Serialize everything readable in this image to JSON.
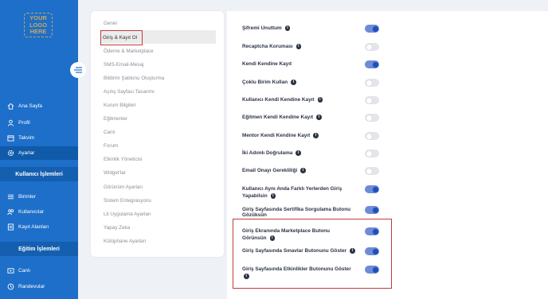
{
  "sidebar": {
    "logo_lines": [
      "YOUR",
      "LOGO",
      "HERE"
    ],
    "items": [
      {
        "label": "Ana Sayfa",
        "icon": "home-icon"
      },
      {
        "label": "Profil",
        "icon": "user-icon"
      },
      {
        "label": "Takvim",
        "icon": "calendar-icon"
      },
      {
        "label": "Ayarlar",
        "icon": "gear-icon"
      },
      {
        "label": "Birimler",
        "icon": "list-icon"
      },
      {
        "label": "Kullanıcılar",
        "icon": "users-icon"
      },
      {
        "label": "Kayıt Alanları",
        "icon": "form-icon"
      },
      {
        "label": "Canlı",
        "icon": "live-icon"
      },
      {
        "label": "Randevular",
        "icon": "appointment-icon"
      }
    ],
    "sections": [
      "Kullanıcı İşlemleri",
      "Eğitim İşlemleri"
    ]
  },
  "menu": {
    "items": [
      "Genel",
      "Giriş & Kayıt Ol",
      "Ödeme & Marketplace",
      "SMS-Email-Mesaj",
      "Bildirim Şablonu Oluşturma",
      "Açılış Sayfası Tasarımı",
      "Kurum Bilgileri",
      "Eğitmenler",
      "Canlı",
      "Forum",
      "Etkinlik Yöneticisi",
      "Widget'lar",
      "Görünüm Ayarları",
      "Sistem Entegrasyonu",
      "Lti Uygulama Ayarları",
      "Yapay Zeka",
      "Kütüphane Ayarları"
    ]
  },
  "settings": [
    {
      "label": "Şifremi Unuttum",
      "info": true,
      "on": true
    },
    {
      "label": "Recaptcha Koruması",
      "info": true,
      "on": false
    },
    {
      "label": "Kendi Kendine Kayıt",
      "info": false,
      "on": true
    },
    {
      "label": "Çoklu Birim Kullan",
      "info": true,
      "on": false
    },
    {
      "label": "Kullanıcı Kendi Kendine Kayıt",
      "info": true,
      "on": false
    },
    {
      "label": "Eğitmen Kendi Kendine Kayıt",
      "info": true,
      "on": false
    },
    {
      "label": "Mentor Kendi Kendine Kayıt",
      "info": true,
      "on": false
    },
    {
      "label": "İki Adımlı Doğrulama",
      "info": true,
      "on": false
    },
    {
      "label": "Email Onayı Gerekliliği",
      "info": true,
      "on": false
    },
    {
      "label_lines": [
        "Kullanıcı Aynı Anda Farklı Yerlerden Giriş",
        "Yapabilsin"
      ],
      "info": true,
      "on": true
    },
    {
      "label_lines": [
        "Giriş Sayfasında Sertifika Sorgulama Butonu",
        "Gözüksün"
      ],
      "info": false,
      "on": true
    },
    {
      "label_lines": [
        "Giriş Ekranında Marketplace Butonu",
        "Görünsün"
      ],
      "info": true,
      "on": true
    },
    {
      "label": "Giriş Sayfasında Sınavlar Butonunu Göster",
      "info": true,
      "on": true
    },
    {
      "label_lines": [
        "Giriş Sayfasında Etkinlikler Butonunu Göster",
        ""
      ],
      "info": true,
      "on": true
    }
  ],
  "colors": {
    "sidebar": "#1d6fc9",
    "toggle_on": "#6e8bd6",
    "highlight": "#c13a3a"
  }
}
